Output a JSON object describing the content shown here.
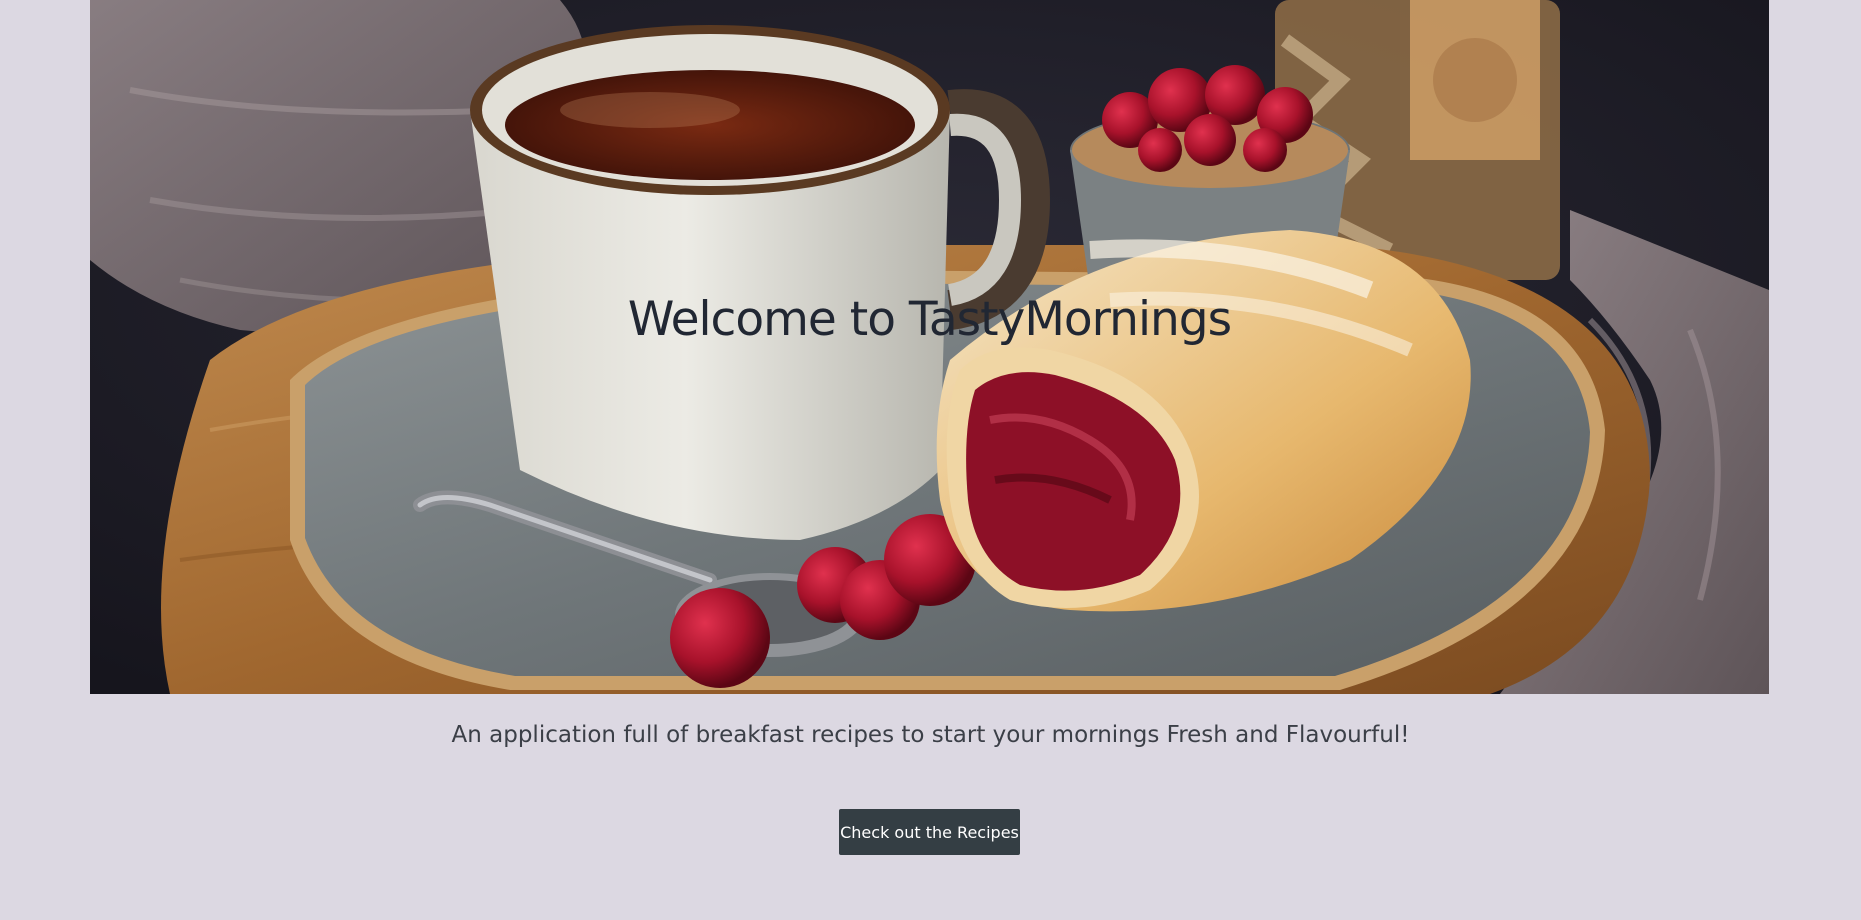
{
  "hero": {
    "title": "Welcome to TastyMornings",
    "image_name": "breakfast-tea-and-cherry-strudel-photo"
  },
  "tagline": "An application full of breakfast recipes to start your mornings Fresh and Flavourful!",
  "cta": {
    "label": "Check out the Recipes"
  },
  "colors": {
    "page_background": "#dcd8e2",
    "button_background": "#343e44",
    "button_text": "#ffffff",
    "title_text": "#212733",
    "tagline_text": "#3b3f47"
  }
}
